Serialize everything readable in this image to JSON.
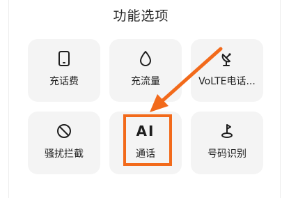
{
  "section": {
    "title": "功能选项"
  },
  "tiles": [
    {
      "label": "充话费",
      "icon": "phone-icon"
    },
    {
      "label": "充流量",
      "icon": "drop-icon"
    },
    {
      "label": "VoLTE电话...",
      "icon": "satellite-dish-icon"
    },
    {
      "label": "骚扰拦截",
      "icon": "block-icon"
    },
    {
      "label": "通话",
      "icon": "ai-text-icon",
      "icon_text": "AI"
    },
    {
      "label": "号码识别",
      "icon": "location-pin-icon"
    }
  ],
  "colors": {
    "accent": "#f26a1b",
    "tile_bg": "#f4f4f4"
  }
}
